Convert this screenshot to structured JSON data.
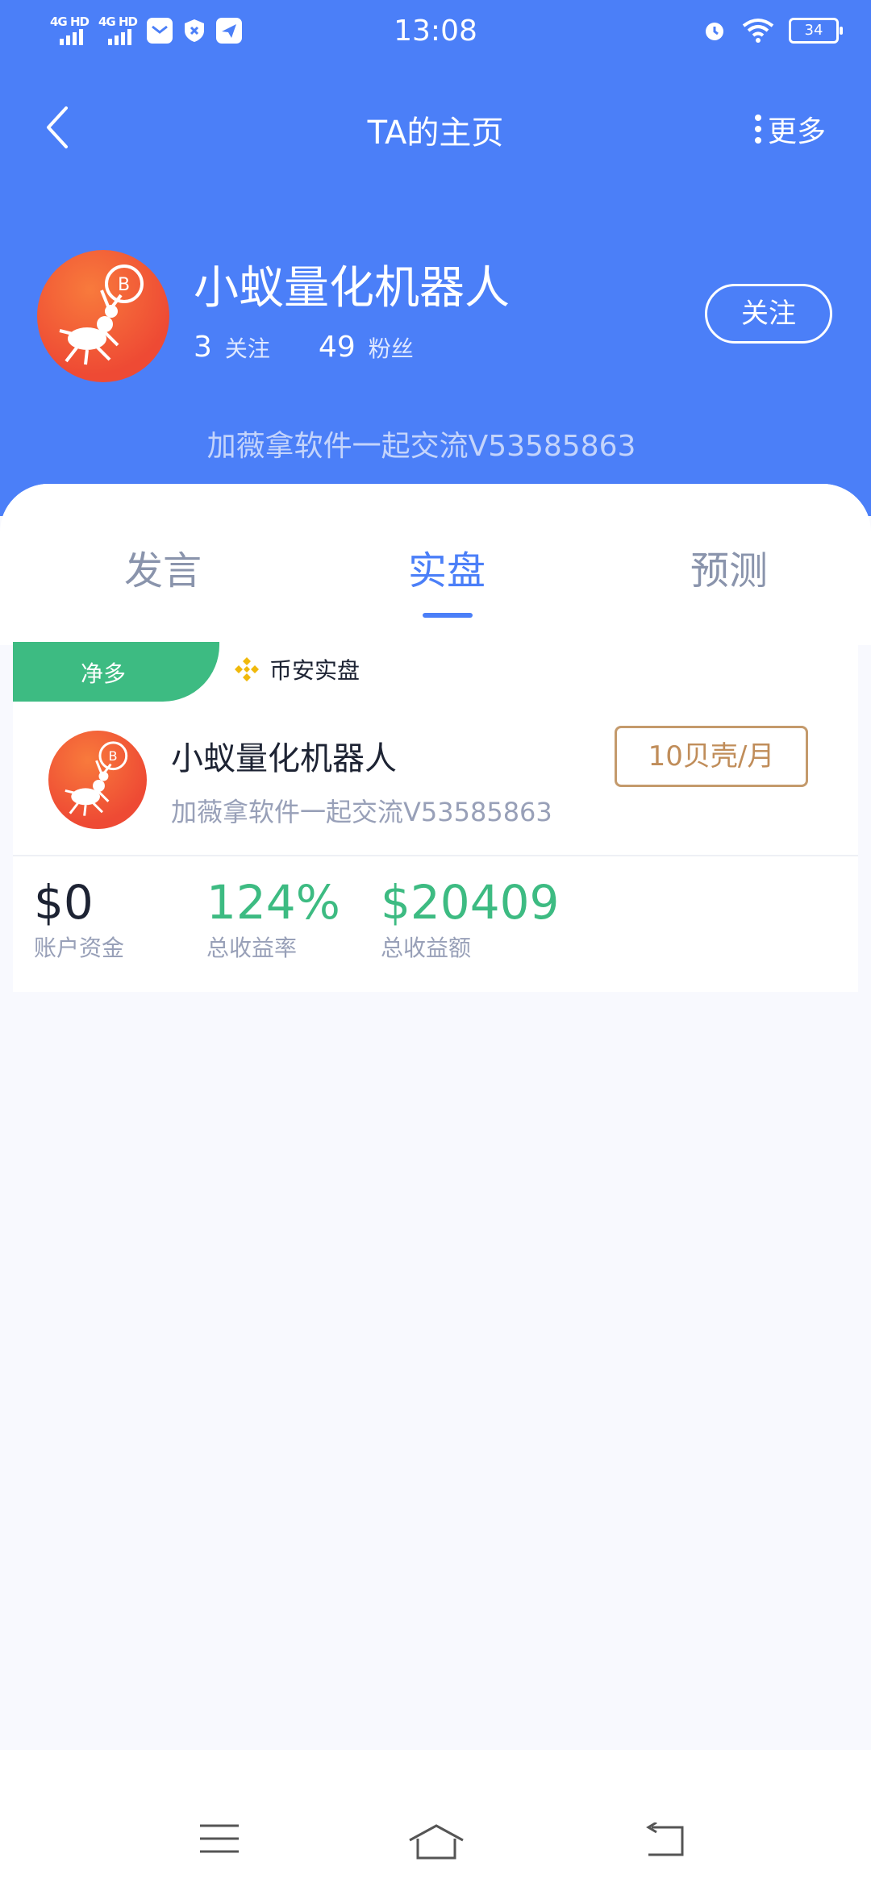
{
  "status_bar": {
    "signal1": "4G HD",
    "signal2": "4G HD",
    "time": "13:08",
    "battery": "34"
  },
  "nav": {
    "title": "TA的主页",
    "more_label": "更多"
  },
  "profile": {
    "name": "小蚁量化机器人",
    "following_count": "3",
    "following_label": "关注",
    "followers_count": "49",
    "followers_label": "粉丝",
    "follow_button": "关注",
    "bio": "加薇拿软件一起交流V53585863"
  },
  "tabs": [
    {
      "label": "发言",
      "active": false
    },
    {
      "label": "实盘",
      "active": true
    },
    {
      "label": "预测",
      "active": false
    }
  ],
  "card": {
    "direction_badge": "净多",
    "exchange": "币安实盘",
    "name": "小蚁量化机器人",
    "bio": "加薇拿软件一起交流V53585863",
    "price": "10贝壳/月",
    "metrics": [
      {
        "value": "$0",
        "label": "账户资金"
      },
      {
        "value": "124%",
        "label": "总收益率"
      },
      {
        "value": "$20409",
        "label": "总收益额"
      }
    ]
  },
  "colors": {
    "header_blue": "#4b7ff8",
    "green": "#3dbb82",
    "gold": "#c08d5a",
    "binance_yellow": "#f0b90b"
  }
}
